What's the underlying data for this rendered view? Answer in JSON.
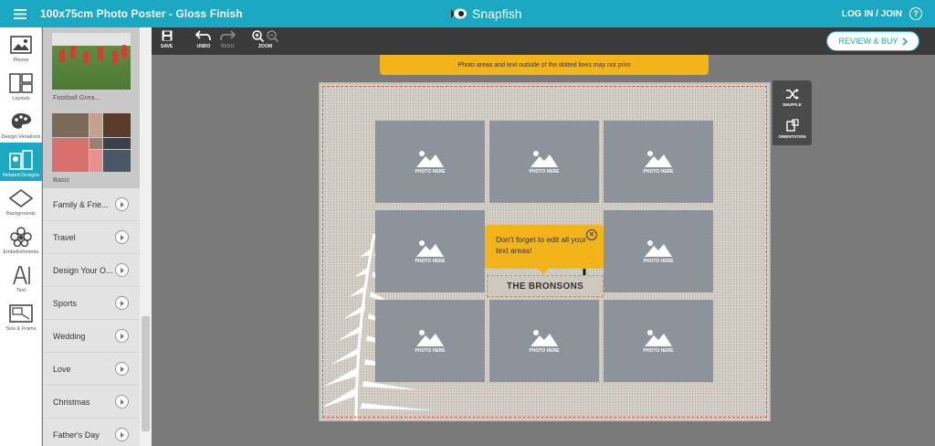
{
  "header": {
    "title": "100x75cm Photo Poster - Gloss Finish",
    "brand": "Snapfish",
    "login": "LOG IN / JOIN",
    "help": "?"
  },
  "rail": [
    {
      "label": "Photos",
      "icon": "photos-icon"
    },
    {
      "label": "Layouts",
      "icon": "layouts-icon"
    },
    {
      "label": "Design Variations",
      "icon": "palette-icon"
    },
    {
      "label": "Related Designs",
      "icon": "related-designs-icon",
      "active": true
    },
    {
      "label": "Backgrounds",
      "icon": "backgrounds-icon"
    },
    {
      "label": "Embellishments",
      "icon": "embellishments-icon"
    },
    {
      "label": "Text",
      "icon": "text-icon"
    },
    {
      "label": "Size & Frame",
      "icon": "size-frame-icon"
    }
  ],
  "panel": {
    "thumb1_caption": "Football Grea...",
    "thumb2_caption": "Basic",
    "categories": [
      "Family & Frie...",
      "Travel",
      "Design Your O...",
      "Sports",
      "Wedding",
      "Love",
      "Christmas",
      "Father's Day"
    ]
  },
  "toolbar": {
    "save": "SAVE",
    "undo": "UNDO",
    "redo": "REDO",
    "zoom": "ZOOM",
    "review": "REVIEW & BUY"
  },
  "banner": "Photo areas and text outside of the dotted lines may not print",
  "canvas": {
    "photo_label": "PHOTO HERE",
    "text_box": "THE BRONSONS",
    "script_glyph": "J"
  },
  "tooltip": {
    "text": "Don't forget to edit all your text areas!"
  },
  "sidefloat": {
    "shuffle": "SHUFFLE",
    "orientation": "ORIENTATION"
  },
  "colors": {
    "brand": "#1ba8c2",
    "accent": "#f3b41b",
    "toolbar": "#3a3a3a",
    "photo_placeholder": "#8c939a"
  }
}
